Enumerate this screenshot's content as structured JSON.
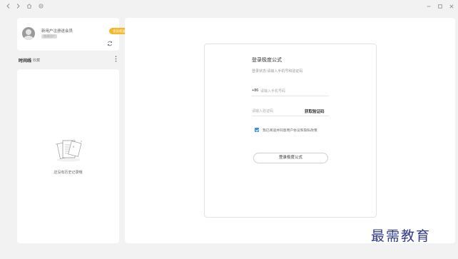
{
  "titlebar": {
    "back_icon": "chevron-left-icon",
    "forward_icon": "chevron-right-icon",
    "home_icon": "home-icon",
    "settings_icon": "gear-icon",
    "minimize_icon": "minimize-icon",
    "maximize_icon": "maximize-icon",
    "close_icon": "close-icon"
  },
  "sidebar": {
    "user_name": "新用户注册送会员",
    "user_tag": "普通用户",
    "vip_label": "会员权益",
    "tabs": {
      "timeline": "时间线",
      "favorites": "收藏"
    },
    "empty_text": "还没有历史记录哦"
  },
  "login": {
    "title": "登录极度公式",
    "subtitle": "登录状态:请输入手机号和验证码",
    "phone_prefix": "+86",
    "phone_placeholder": "请输入手机号码",
    "code_placeholder": "请输入验证码",
    "get_code_label": "获取验证码",
    "agreement_text": "我已阅读并同意用户协议和隐私政策",
    "agreement_checked": true,
    "login_button": "登录极度公式"
  },
  "watermark": "最需教育",
  "colors": {
    "accent": "#3a8ee6",
    "vip": "#f4b82e",
    "watermark": "#2f3a8f"
  }
}
